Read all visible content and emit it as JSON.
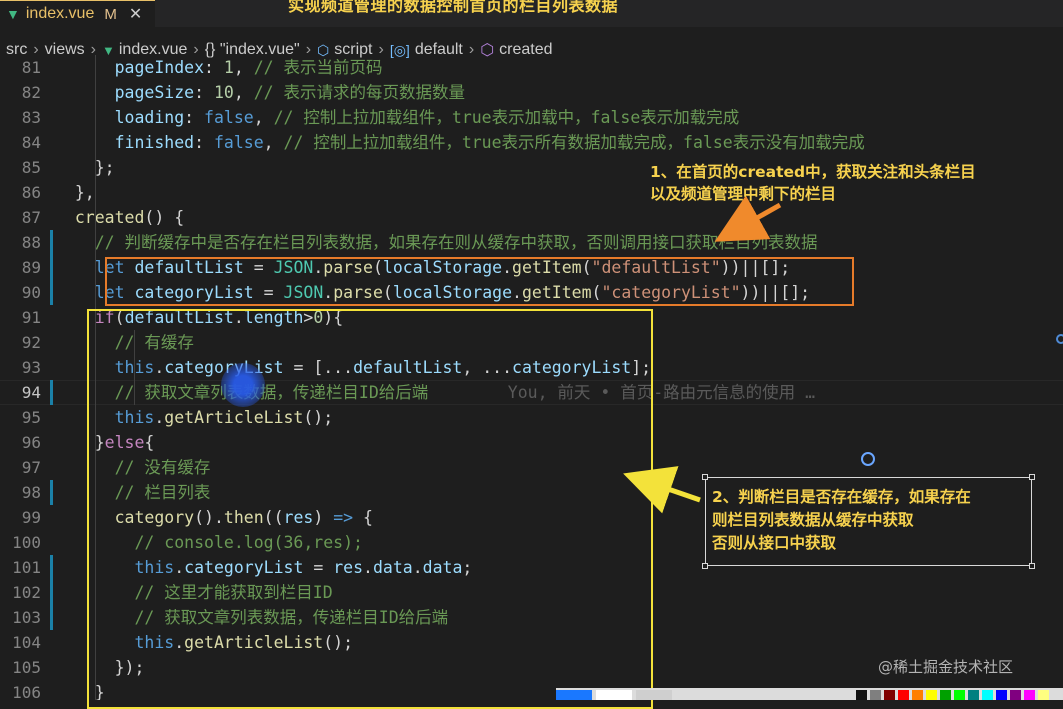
{
  "tab": {
    "filename": "index.vue",
    "modified": "M",
    "close": "✕"
  },
  "banner": "实现频道管理的数据控制首页的栏目列表数据",
  "breadcrumb": {
    "items": [
      "src",
      "views",
      "index.vue",
      "{} \"index.vue\"",
      "script",
      "default",
      "created"
    ]
  },
  "lines": [
    {
      "n": "81",
      "html": "      <span class='var'>pageIndex</span>: <span class='num'>1</span>, <span class='cm'>// 表示当前页码</span>"
    },
    {
      "n": "82",
      "html": "      <span class='var'>pageSize</span>: <span class='num'>10</span>, <span class='cm'>// 表示请求的每页数据数量</span>"
    },
    {
      "n": "83",
      "html": "      <span class='var'>loading</span>: <span class='kw'>false</span>, <span class='cm'>// 控制上拉加载组件，true表示加载中，false表示加载完成</span>"
    },
    {
      "n": "84",
      "html": "      <span class='var'>finished</span>: <span class='kw'>false</span>, <span class='cm'>// 控制上拉加载组件，true表示所有数据加载完成，false表示没有加载完成</span>"
    },
    {
      "n": "85",
      "html": "    };"
    },
    {
      "n": "86",
      "html": "  },"
    },
    {
      "n": "87",
      "html": "  <span class='fn'>created</span>() {"
    },
    {
      "n": "88",
      "html": "    <span class='cm'>// 判断缓存中是否存在栏目列表数据，如果存在则从缓存中获取，否则调用接口获取栏目列表数据</span>"
    },
    {
      "n": "89",
      "html": "    <span class='kw'>let</span> <span class='var'>defaultList</span> = <span class='cls'>JSON</span>.<span class='fn'>parse</span>(<span class='var'>localStorage</span>.<span class='fn'>getItem</span>(<span class='str'>\"defaultList\"</span>))||[];"
    },
    {
      "n": "90",
      "html": "    <span class='kw'>let</span> <span class='var'>categoryList</span> = <span class='cls'>JSON</span>.<span class='fn'>parse</span>(<span class='var'>localStorage</span>.<span class='fn'>getItem</span>(<span class='str'>\"categoryList\"</span>))||[];"
    },
    {
      "n": "91",
      "html": "    <span class='ctrl'>if</span>(<span class='var'>defaultList</span>.<span class='var'>length</span>&gt;<span class='num'>0</span>){"
    },
    {
      "n": "92",
      "html": "      <span class='cm'>// 有缓存</span>"
    },
    {
      "n": "93",
      "html": "      <span class='kw'>this</span>.<span class='var'>categoryList</span> = [...<span class='var'>defaultList</span>, ...<span class='var'>categoryList</span>];"
    },
    {
      "n": "94",
      "html": "      <span class='cm'>// 获取文章列表数据，传递栏目ID给后端</span>        <span class='blame'>You, 前天 • 首页-路由元信息的使用 …</span>",
      "active": true
    },
    {
      "n": "95",
      "html": "      <span class='kw'>this</span>.<span class='fn'>getArticleList</span>();"
    },
    {
      "n": "96",
      "html": "    }<span class='ctrl'>else</span>{"
    },
    {
      "n": "97",
      "html": "      <span class='cm'>// 没有缓存</span>"
    },
    {
      "n": "98",
      "html": "      <span class='cm'>// 栏目列表</span>"
    },
    {
      "n": "99",
      "html": "      <span class='fn'>category</span>().<span class='fn'>then</span>((<span class='var'>res</span>) <span class='kw'>=&gt;</span> {"
    },
    {
      "n": "100",
      "html": "        <span class='cm'>// console.log(36,res);</span>"
    },
    {
      "n": "101",
      "html": "        <span class='kw'>this</span>.<span class='var'>categoryList</span> = <span class='var'>res</span>.<span class='var'>data</span>.<span class='var'>data</span>;"
    },
    {
      "n": "102",
      "html": "        <span class='cm'>// 这里才能获取到栏目ID</span>"
    },
    {
      "n": "103",
      "html": "        <span class='cm'>// 获取文章列表数据，传递栏目ID给后端</span>"
    },
    {
      "n": "104",
      "html": "        <span class='kw'>this</span>.<span class='fn'>getArticleList</span>();"
    },
    {
      "n": "105",
      "html": "      });"
    },
    {
      "n": "106",
      "html": "    }"
    }
  ],
  "annotations": {
    "note1": "1、在首页的created中，获取关注和头条栏目\n以及频道管理中剩下的栏目",
    "note2": "2、判断栏目是否存在缓存，如果存在\n则栏目列表数据从缓存中获取\n否则从接口中获取"
  },
  "watermark": "@稀土掘金技术社区",
  "colors": {
    "orange_box": "#e67b2a",
    "yellow_box": "#f3e23a",
    "note_text": "#f7d24e"
  },
  "palette": [
    "#1a78ff",
    "#ffffff",
    "#cfcfcf",
    "#111111",
    "#7f7f7f",
    "#7f0000",
    "#ff0000",
    "#ff7f00",
    "#ffff00",
    "#00a000",
    "#00ff00",
    "#008080",
    "#00ffff",
    "#0000ff",
    "#800080",
    "#ff00ff",
    "#ffff80"
  ]
}
